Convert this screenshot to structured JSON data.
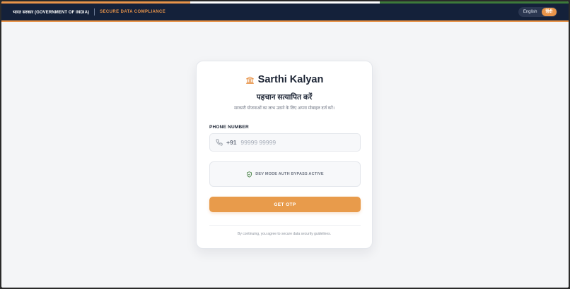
{
  "header": {
    "government_label": "भारत सरकार (GOVERNMENT OF INDIA)",
    "compliance_label": "SECURE DATA COMPLIANCE",
    "languages": [
      "English",
      "हिंदी"
    ],
    "active_language": "हिंदी"
  },
  "brand": {
    "name": "Sarthi Kalyan",
    "icon": "bank-icon"
  },
  "login": {
    "title": "पहचान सत्यापित करें",
    "subtitle": "सरकारी योजनाओं का लाभ उठाने के लिए अपना मोबाइल दर्ज करें।",
    "phone_label": "PHONE NUMBER",
    "phone_prefix": "+91",
    "phone_placeholder": "99999 99999",
    "phone_value": "",
    "dev_notice": "DEV MODE AUTH BYPASS ACTIVE",
    "submit_label": "GET OTP",
    "footer_note": "By continuing, you agree to secure data security guidelines."
  },
  "colors": {
    "header_bg": "#14213a",
    "accent_saffron": "#e8944a",
    "accent_green": "#3d7a3a",
    "page_bg": "#f4f5f7"
  }
}
